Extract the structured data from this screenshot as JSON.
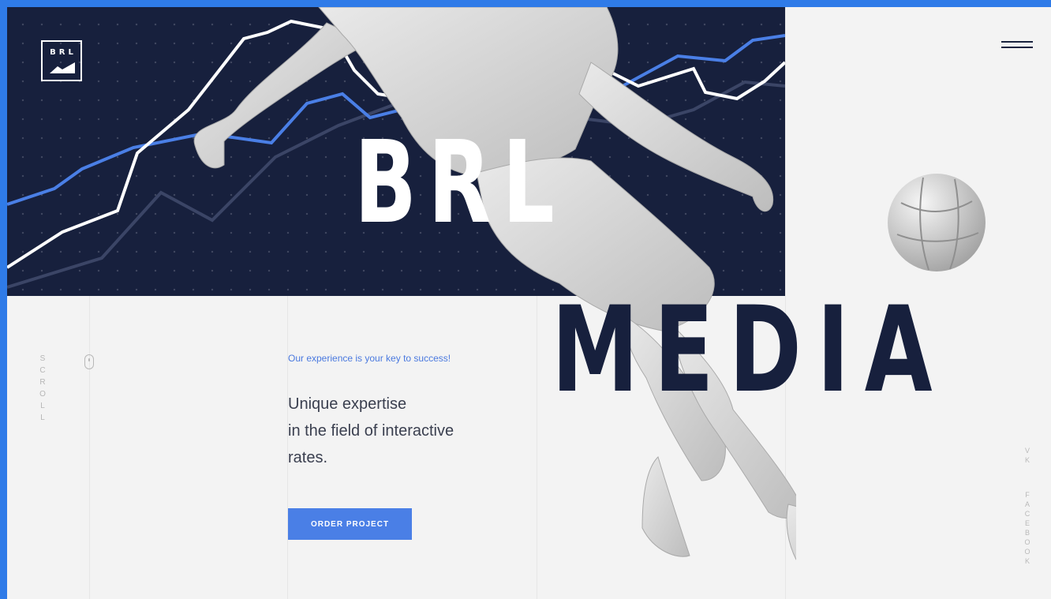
{
  "brand": {
    "logo_text": "BRL",
    "title_top": "BRL",
    "title_bottom": "MEDIA"
  },
  "hero": {
    "tagline": "Our experience is your key to success!",
    "headline_lines": [
      "Unique expertise",
      "in the field of interactive",
      "rates."
    ],
    "cta_label": "ORDER PROJECT"
  },
  "sidebar": {
    "scroll_letters": [
      "S",
      "C",
      "R",
      "O",
      "L",
      "L"
    ]
  },
  "social": {
    "vk_letters": [
      "V",
      "K"
    ],
    "facebook_letters": [
      "F",
      "A",
      "C",
      "E",
      "B",
      "O",
      "O",
      "K"
    ]
  },
  "icons": {
    "menu": "hamburger-icon",
    "scroll": "mouse-icon",
    "logo": "mountain-icon"
  },
  "colors": {
    "outer_background": "#2f7be8",
    "dark_panel": "#17203d",
    "accent_blue": "#4a7fe6",
    "light_background": "#f3f3f3"
  }
}
